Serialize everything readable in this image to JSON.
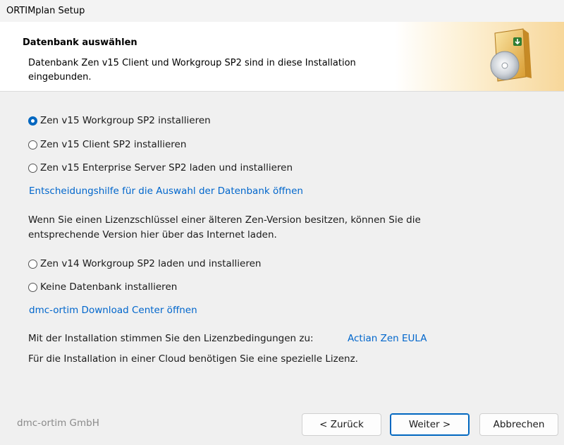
{
  "window": {
    "title": "ORTIMplan Setup"
  },
  "header": {
    "title": "Datenbank auswählen",
    "description": "Datenbank Zen v15 Client und Workgroup SP2 sind in diese Installation eingebunden.",
    "icon": "setup-disc-icon"
  },
  "options_group1": [
    {
      "label": "Zen v15 Workgroup SP2 installieren",
      "selected": true
    },
    {
      "label": "Zen v15 Client SP2 installieren",
      "selected": false
    },
    {
      "label": "Zen v15 Enterprise Server SP2 laden und installieren",
      "selected": false
    }
  ],
  "decision_link": "Entscheidungshilfe für die Auswahl der Datenbank öffnen",
  "license_info": "Wenn Sie einen Lizenzschlüssel einer älteren Zen-Version besitzen, können Sie die entsprechende Version hier über das Internet laden.",
  "options_group2": [
    {
      "label": "Zen v14 Workgroup SP2 laden und installieren",
      "selected": false
    },
    {
      "label": "Keine Datenbank installieren",
      "selected": false
    }
  ],
  "download_link": "dmc-ortim Download Center öffnen",
  "eula": {
    "prefix": "Mit der Installation stimmen Sie den Lizenzbedingungen zu:",
    "link": "Actian Zen EULA"
  },
  "cloud_note": "Für die Installation in einer Cloud benötigen Sie eine spezielle Lizenz.",
  "footer": {
    "brand": "dmc-ortim GmbH",
    "back_label": "< Zurück",
    "next_label": "Weiter >",
    "cancel_label": "Abbrechen"
  },
  "colors": {
    "accent": "#0067c0",
    "link": "#0066cc",
    "panel": "#f0f0f0"
  }
}
